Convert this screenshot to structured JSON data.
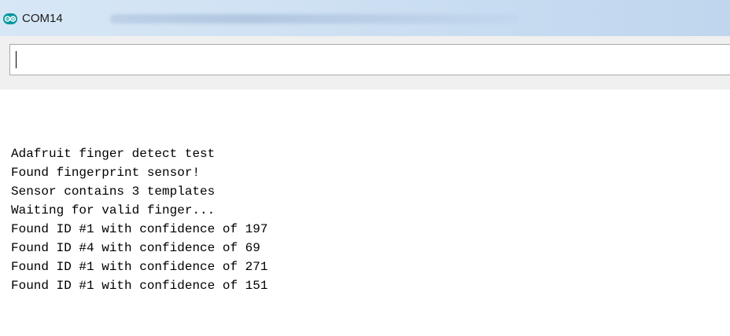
{
  "window": {
    "title": "COM14",
    "icon": "arduino-infinity-icon"
  },
  "input": {
    "value": ""
  },
  "output": {
    "lines": [
      "Adafruit finger detect test",
      "Found fingerprint sensor!",
      "Sensor contains 3 templates",
      "Waiting for valid finger...",
      "Found ID #1 with confidence of 197",
      "Found ID #4 with confidence of 69",
      "Found ID #1 with confidence of 271",
      "Found ID #1 with confidence of 151"
    ]
  },
  "colors": {
    "titlebar": "#cfe1f3",
    "icon": "#00979c"
  }
}
